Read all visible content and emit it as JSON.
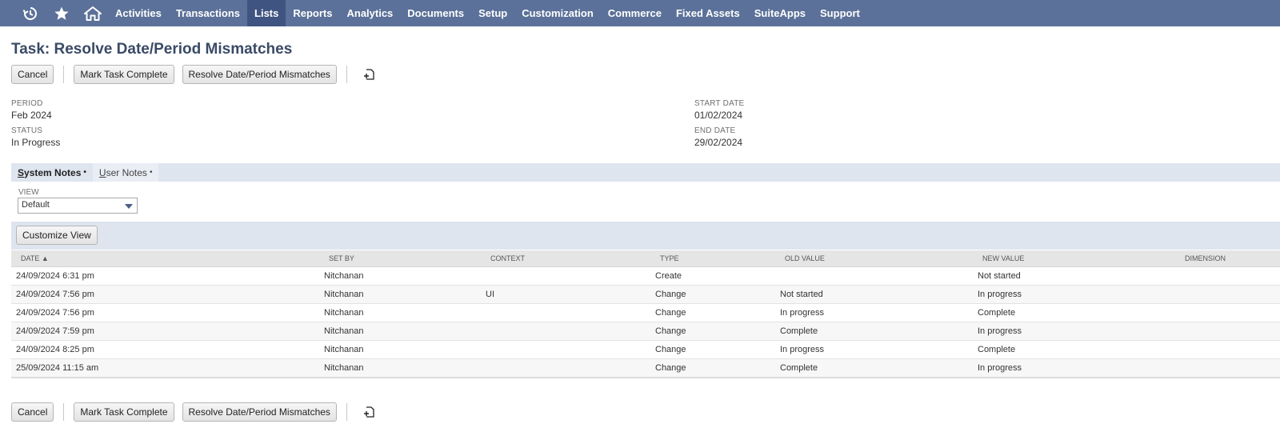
{
  "nav": {
    "items": [
      {
        "label": "Activities",
        "active": false
      },
      {
        "label": "Transactions",
        "active": false
      },
      {
        "label": "Lists",
        "active": true
      },
      {
        "label": "Reports",
        "active": false
      },
      {
        "label": "Analytics",
        "active": false
      },
      {
        "label": "Documents",
        "active": false
      },
      {
        "label": "Setup",
        "active": false
      },
      {
        "label": "Customization",
        "active": false
      },
      {
        "label": "Commerce",
        "active": false
      },
      {
        "label": "Fixed Assets",
        "active": false
      },
      {
        "label": "SuiteApps",
        "active": false
      },
      {
        "label": "Support",
        "active": false
      }
    ],
    "icons": [
      "recent-history-icon",
      "star-icon",
      "home-icon"
    ]
  },
  "page": {
    "title": "Task: Resolve Date/Period Mismatches"
  },
  "toolbar": {
    "cancel": "Cancel",
    "mark_complete": "Mark Task Complete",
    "resolve": "Resolve Date/Period Mismatches"
  },
  "fields": {
    "period_label": "PERIOD",
    "period_value": "Feb 2024",
    "status_label": "STATUS",
    "status_value": "In Progress",
    "start_label": "START DATE",
    "start_value": "01/02/2024",
    "end_label": "END DATE",
    "end_value": "29/02/2024"
  },
  "tabs": {
    "system_first": "S",
    "system_rest": "ystem Notes",
    "user_first": "U",
    "user_rest": "ser Notes",
    "dot": "•"
  },
  "view": {
    "label": "VIEW",
    "selected": "Default"
  },
  "customize_label": "Customize View",
  "table": {
    "headers": [
      "DATE ▲",
      "SET BY",
      "CONTEXT",
      "TYPE",
      "OLD VALUE",
      "NEW VALUE",
      "DIMENSION"
    ],
    "rows": [
      [
        "24/09/2024 6:31 pm",
        "Nitchanan",
        "",
        "Create",
        "",
        "Not started",
        ""
      ],
      [
        "24/09/2024 7:56 pm",
        "Nitchanan",
        "UI",
        "Change",
        "Not started",
        "In progress",
        ""
      ],
      [
        "24/09/2024 7:56 pm",
        "Nitchanan",
        "",
        "Change",
        "In progress",
        "Complete",
        ""
      ],
      [
        "24/09/2024 7:59 pm",
        "Nitchanan",
        "",
        "Change",
        "Complete",
        "In progress",
        ""
      ],
      [
        "24/09/2024 8:25 pm",
        "Nitchanan",
        "",
        "Change",
        "In progress",
        "Complete",
        ""
      ],
      [
        "25/09/2024 11:15 am",
        "Nitchanan",
        "",
        "Change",
        "Complete",
        "In progress",
        ""
      ]
    ]
  }
}
